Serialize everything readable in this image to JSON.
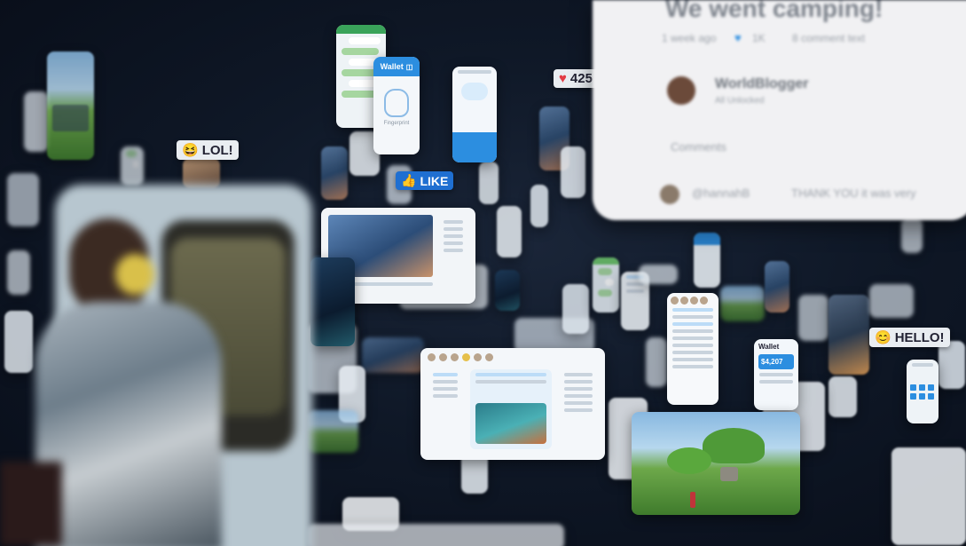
{
  "reactions": {
    "lol": "LOL!",
    "like": "LIKE",
    "hello": "HELLO!",
    "heart_count": "425"
  },
  "wallet": {
    "title": "Wallet",
    "label": "Fingerprint",
    "balance": "$4,207"
  },
  "post_panel": {
    "title": "We went camping!",
    "time": "1 week ago",
    "likes": "1K",
    "comment_stat": "8 comment text",
    "author": "WorldBlogger",
    "author_sub": "All Unlocked",
    "comments_label": "Comments",
    "commenter": "@hannahB",
    "comment": "THANK YOU it was very"
  },
  "colors": {
    "background": "#0d1524",
    "wallet_blue": "#2c8ee0",
    "like_blue": "#1f6fd1",
    "heart_red": "#e23b44",
    "chat_green": "#6cc36a"
  },
  "icons": [
    "laughing-emoji-icon",
    "thumbs-up-icon",
    "heart-icon",
    "waving-emoji-icon",
    "fingerprint-icon",
    "wallet-icon"
  ]
}
